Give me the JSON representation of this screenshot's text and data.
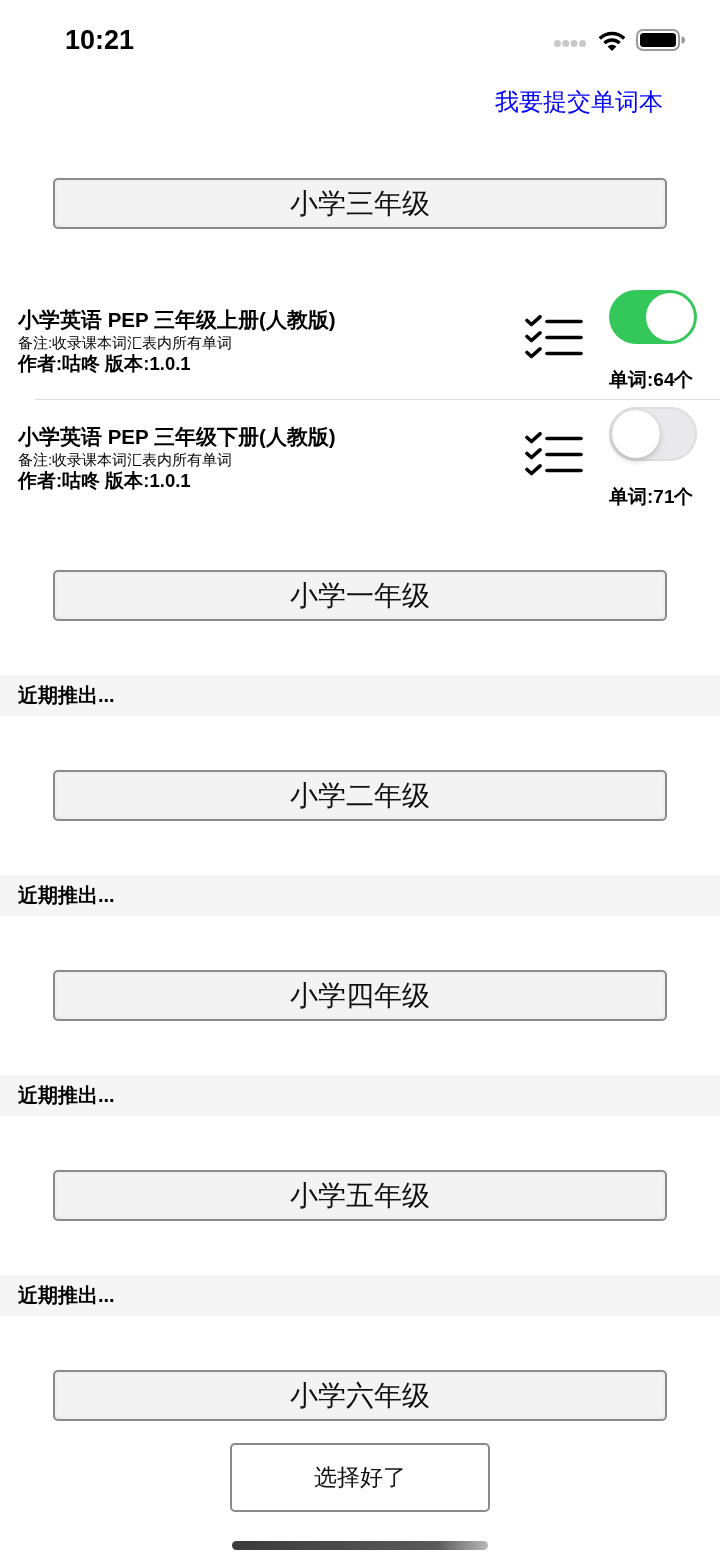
{
  "status_bar": {
    "time": "10:21"
  },
  "header": {
    "link": "我要提交单词本"
  },
  "sections": [
    {
      "kind": "books",
      "grade": "小学三年级",
      "books": [
        {
          "title": "小学英语 PEP 三年级上册(人教版)",
          "note": "备注:收录课本词汇表内所有单词",
          "author": "作者:咕咚 版本:1.0.1",
          "on": true,
          "words": "单词:64个"
        },
        {
          "title": "小学英语 PEP 三年级下册(人教版)",
          "note": "备注:收录课本词汇表内所有单词",
          "author": "作者:咕咚 版本:1.0.1",
          "on": false,
          "words": "单词:71个"
        }
      ]
    },
    {
      "kind": "soon",
      "grade": "小学一年级",
      "notice": "近期推出..."
    },
    {
      "kind": "soon",
      "grade": "小学二年级",
      "notice": "近期推出..."
    },
    {
      "kind": "soon",
      "grade": "小学四年级",
      "notice": "近期推出..."
    },
    {
      "kind": "soon",
      "grade": "小学五年级",
      "notice": "近期推出..."
    },
    {
      "kind": "empty",
      "grade": "小学六年级"
    }
  ],
  "confirm_button": "选择好了"
}
